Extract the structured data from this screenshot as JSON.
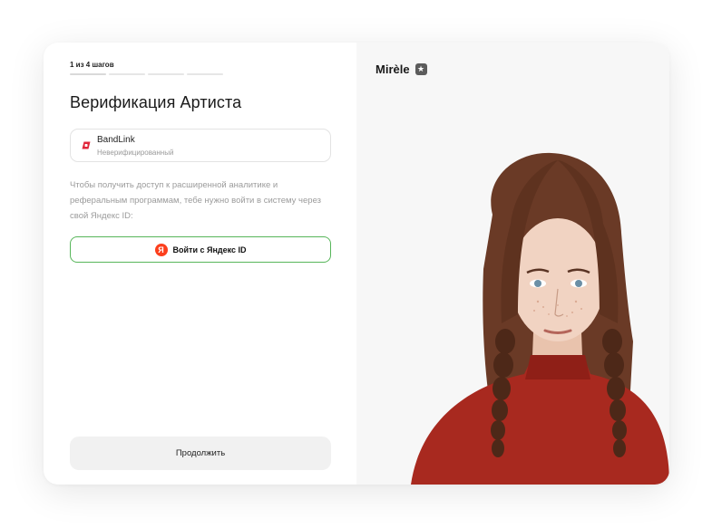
{
  "steps": {
    "label": "1 из 4 шагов",
    "total": 4,
    "current": 1
  },
  "title": "Верификация Артиста",
  "platform": {
    "name": "BandLink",
    "status": "Неверифицированный",
    "icon": "bandlink-logo"
  },
  "description": "Чтобы получить доступ к расширенной аналитике и реферальным программам, тебе нужно войти в систему через свой Яндекс ID:",
  "yandex_button": {
    "label": "Войти с Яндекс ID",
    "icon_letter": "Я"
  },
  "continue_button": {
    "label": "Продолжить"
  },
  "artist": {
    "name": "Mirèle",
    "badge_icon": "star-badge-icon"
  },
  "colors": {
    "accent_green": "#57b65a",
    "yandex_red": "#fc3f1d",
    "bandlink_red": "#e0263a"
  }
}
